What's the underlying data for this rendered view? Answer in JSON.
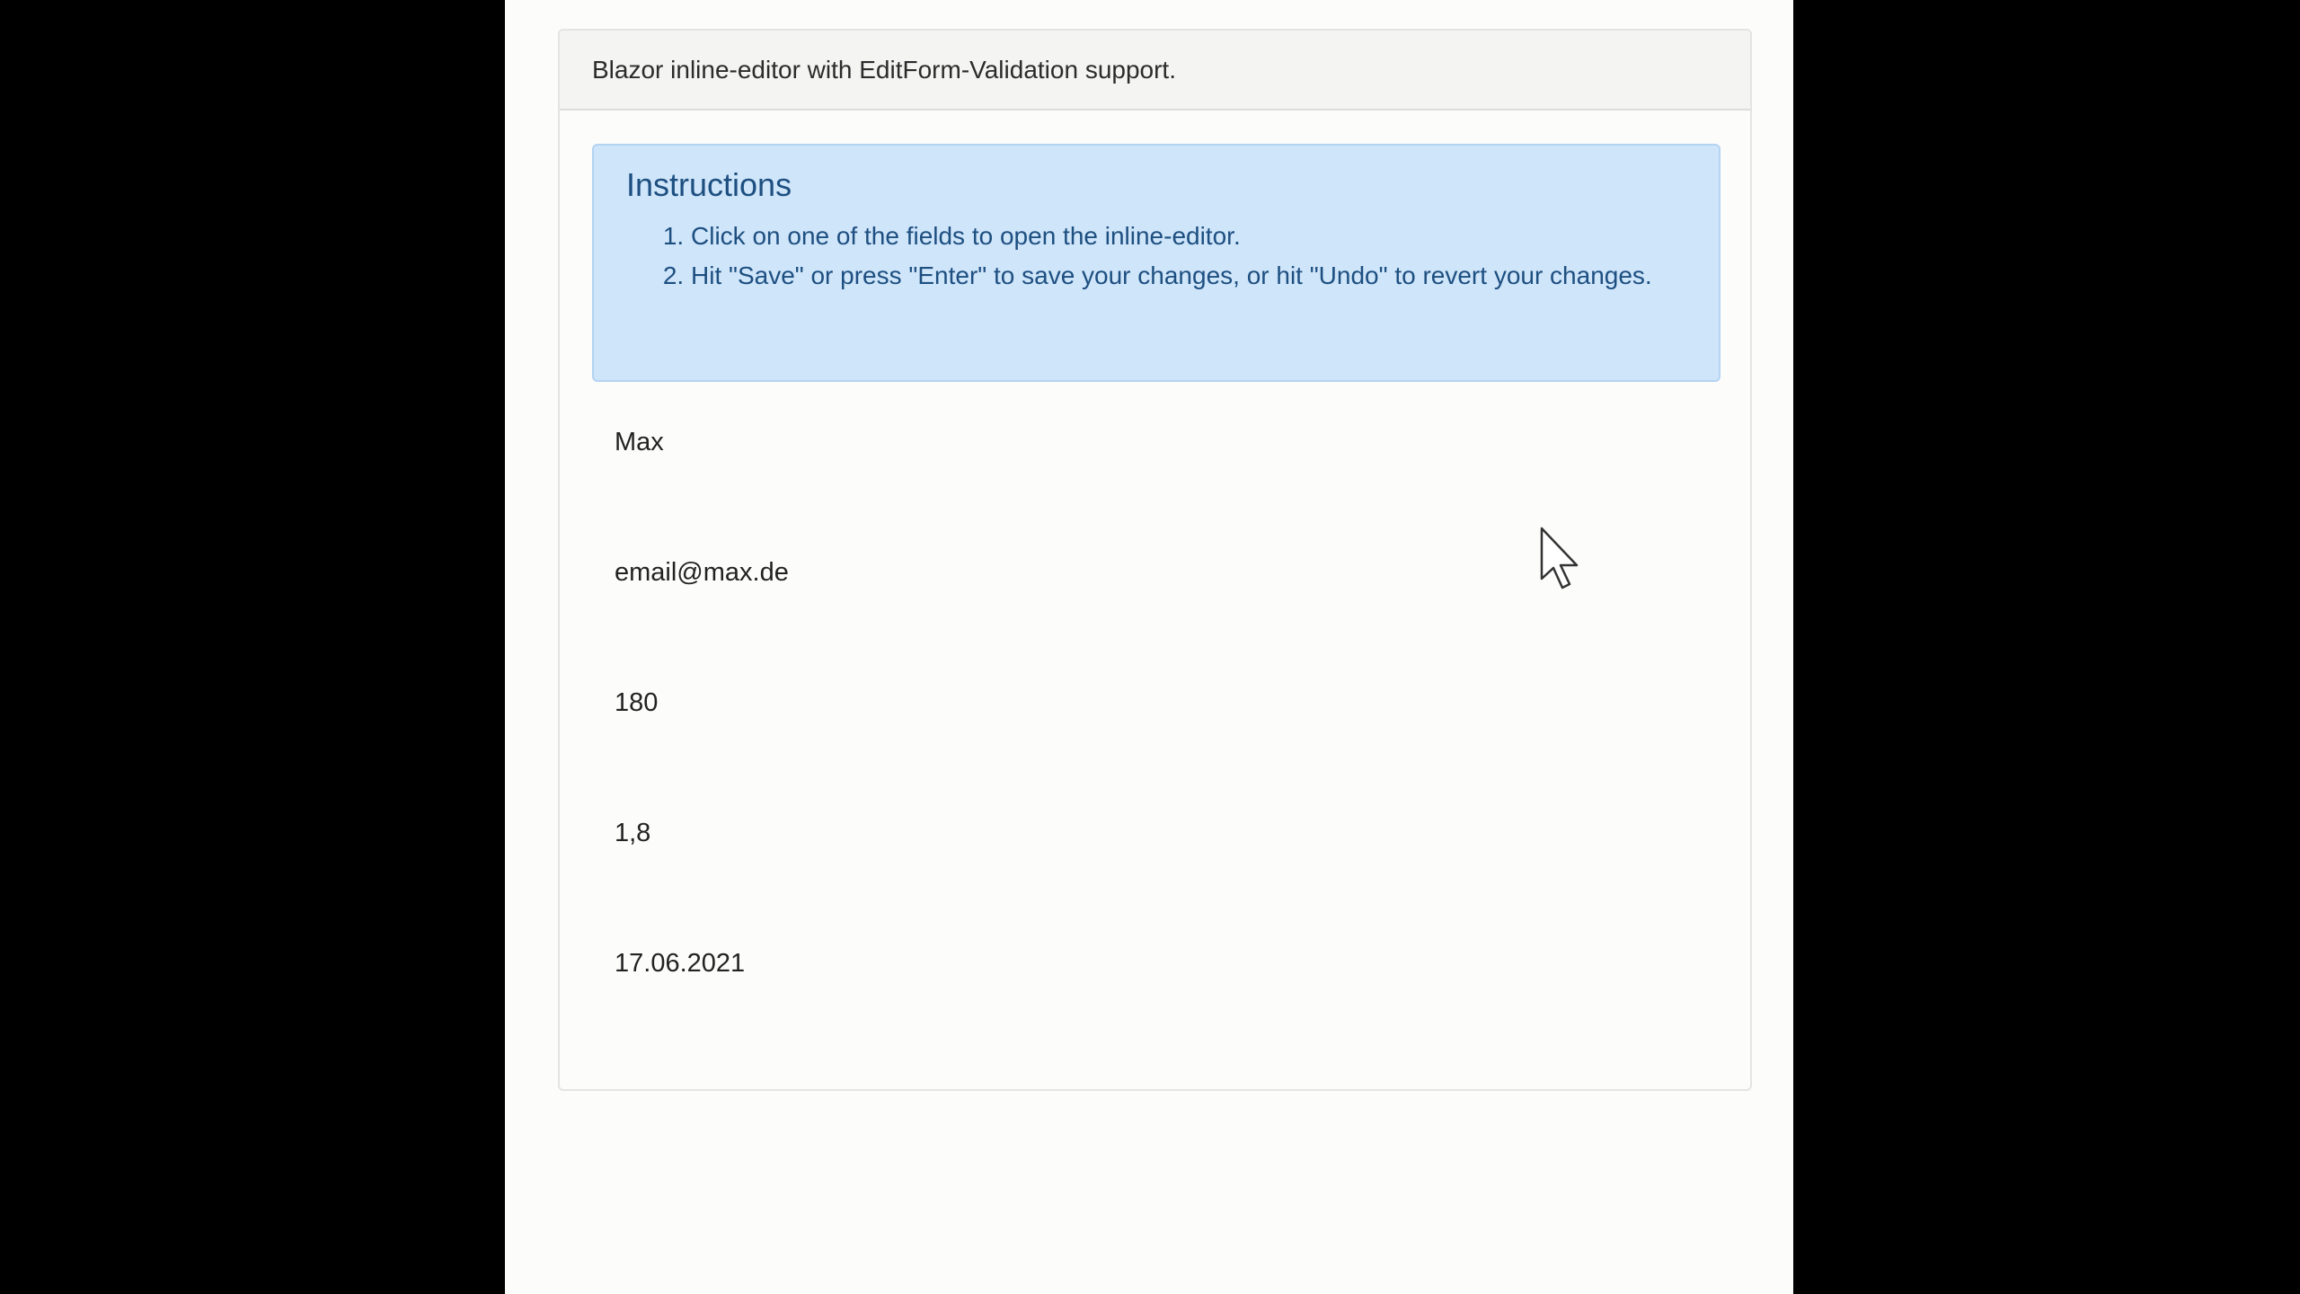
{
  "panel": {
    "heading": "Blazor inline-editor with EditForm-Validation support."
  },
  "instructions": {
    "title": "Instructions",
    "steps": [
      "Click on one of the fields to open the inline-editor.",
      "Hit \"Save\" or press \"Enter\" to save your changes, or hit \"Undo\" to revert your changes."
    ]
  },
  "fields": [
    {
      "value": "Max"
    },
    {
      "value": "email@max.de"
    },
    {
      "value": "180"
    },
    {
      "value": "1,8"
    },
    {
      "value": "17.06.2021"
    }
  ],
  "pointer": {
    "icon": "mouse-pointer-icon"
  }
}
